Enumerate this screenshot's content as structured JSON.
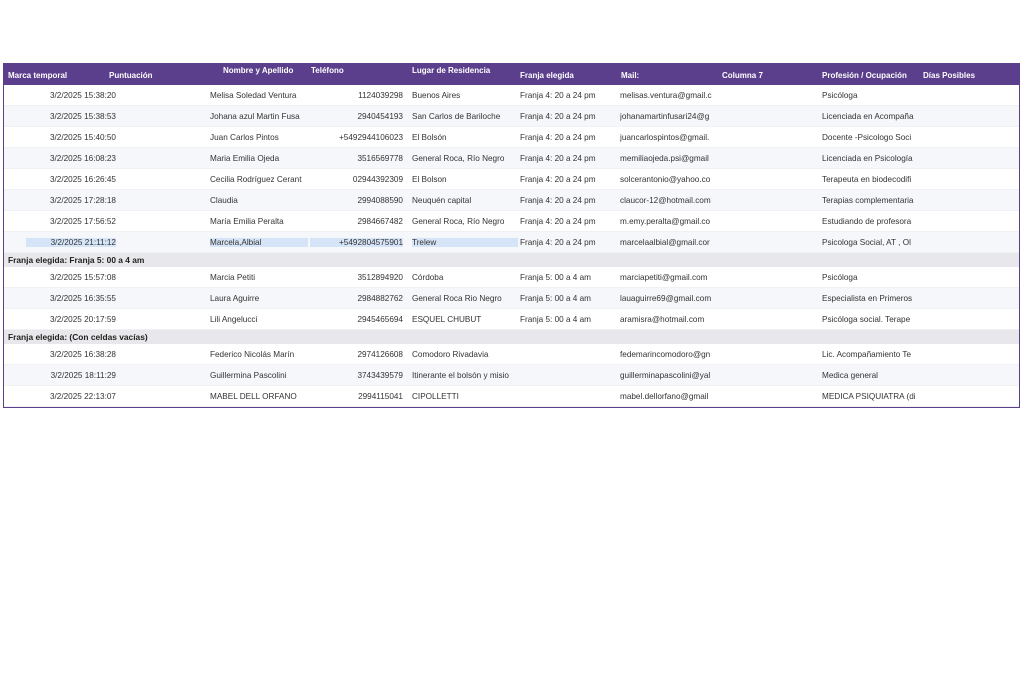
{
  "headers": {
    "timestamp": "Marca temporal",
    "score": "Puntuación",
    "name": "Nombre y Apellido",
    "phone": "Teléfono",
    "residence": "Lugar de Residencia",
    "slot": "Franja elegida",
    "mail": "Mail:",
    "col7": "Columna 7",
    "profession": "Profesión / Ocupación",
    "days": "Días Posibles"
  },
  "groups": [
    {
      "label": "",
      "rows": [
        {
          "ts": "3/2/2025 15:38:20",
          "name": "Melisa Soledad Ventura",
          "tel": "1124039298",
          "loc": "Buenos Aires",
          "slot": "Franja 4: 20 a 24 pm",
          "mail": "melisas.ventura@gmail.c",
          "prof": "Psicóloga"
        },
        {
          "ts": "3/2/2025 15:38:53",
          "name": "Johana azul Martin Fusa",
          "tel": "2940454193",
          "loc": "San Carlos de Bariloche",
          "slot": "Franja 4: 20 a 24 pm",
          "mail": "johanamartinfusari24@g",
          "prof": "Licenciada en Acompaña"
        },
        {
          "ts": "3/2/2025 15:40:50",
          "name": "Juan Carlos Pintos",
          "tel": "+5492944106023",
          "loc": "El Bolsón",
          "slot": "Franja 4: 20 a 24 pm",
          "mail": "juancarlospintos@gmail.",
          "prof": "Docente -Psicologo Soci"
        },
        {
          "ts": "3/2/2025 16:08:23",
          "name": "Maria Emilia Ojeda",
          "tel": "3516569778",
          "loc": "General Roca, Río Negro",
          "slot": "Franja 4: 20 a 24 pm",
          "mail": "memiliaojeda.psi@gmail",
          "prof": "Licenciada en Psicología"
        },
        {
          "ts": "3/2/2025 16:26:45",
          "name": "Cecilia Rodríguez Cerant",
          "tel": "02944392309",
          "loc": "El Bolson",
          "slot": "Franja 4: 20 a 24 pm",
          "mail": "solcerantonio@yahoo.co",
          "prof": "Terapeuta en biodecodifi"
        },
        {
          "ts": "3/2/2025 17:28:18",
          "name": "Claudia",
          "tel": "2994088590",
          "loc": "Neuquén capital",
          "slot": "Franja 4: 20 a 24 pm",
          "mail": "claucor-12@hotmail.com",
          "prof": "Terapias complementaria"
        },
        {
          "ts": "3/2/2025 17:56:52",
          "name": "María Emilia Peralta",
          "tel": "2984667482",
          "loc": "General Roca, Río Negro",
          "slot": "Franja 4: 20 a 24 pm",
          "mail": "m.emy.peralta@gmail.co",
          "prof": "Estudiando de profesora"
        },
        {
          "ts": "3/2/2025 21:11:12",
          "name": "Marcela,Albial",
          "tel": "+5492804575901",
          "loc": "Trelew",
          "slot": "Franja 4: 20 a 24 pm",
          "mail": "marcelaalbial@gmail.cor",
          "prof": "Psicologa  Social, AT , Ol",
          "selected": true
        }
      ]
    },
    {
      "label": "Franja elegida: Franja 5: 00 a 4 am",
      "rows": [
        {
          "ts": "3/2/2025 15:57:08",
          "name": "Marcia Petiti",
          "tel": "3512894920",
          "loc": "Córdoba",
          "slot": "Franja 5: 00 a 4 am",
          "mail": "marciapetiti@gmail.com",
          "prof": "Psicóloga"
        },
        {
          "ts": "3/2/2025 16:35:55",
          "name": "Laura Aguirre",
          "tel": "2984882762",
          "loc": "General Roca Rio Negro",
          "slot": "Franja 5: 00 a 4 am",
          "mail": "lauaguirre69@gmail.com",
          "prof": "Especialista en Primeros"
        },
        {
          "ts": "3/2/2025 20:17:59",
          "name": "Lili Angelucci",
          "tel": "2945465694",
          "loc": "ESQUEL CHUBUT",
          "slot": "Franja 5: 00 a 4 am",
          "mail": "aramisra@hotmail.com",
          "prof": "Psicóloga social. Terape"
        }
      ]
    },
    {
      "label": "Franja elegida: (Con celdas vacías)",
      "rows": [
        {
          "ts": "3/2/2025 16:38:28",
          "name": "Federico Nicolás Marín",
          "tel": "2974126608",
          "loc": "Comodoro Rivadavia",
          "slot": "",
          "mail": "fedemarincomodoro@gn",
          "prof": "Lic. Acompañamiento Te"
        },
        {
          "ts": "3/2/2025 18:11:29",
          "name": "Guillermina Pascolini",
          "tel": "3743439579",
          "loc": "Itinerante el bolsón y misio",
          "slot": "",
          "mail": "guillerminapascolini@yal",
          "prof": "Medica general"
        },
        {
          "ts": "3/2/2025 22:13:07",
          "name": "MABEL DELL ORFANO",
          "tel": "2994115041",
          "loc": "CIPOLLETTI",
          "slot": "",
          "mail": "mabel.dellorfano@gmail",
          "prof": "MEDICA PSIQUIATRA (di"
        }
      ]
    }
  ]
}
